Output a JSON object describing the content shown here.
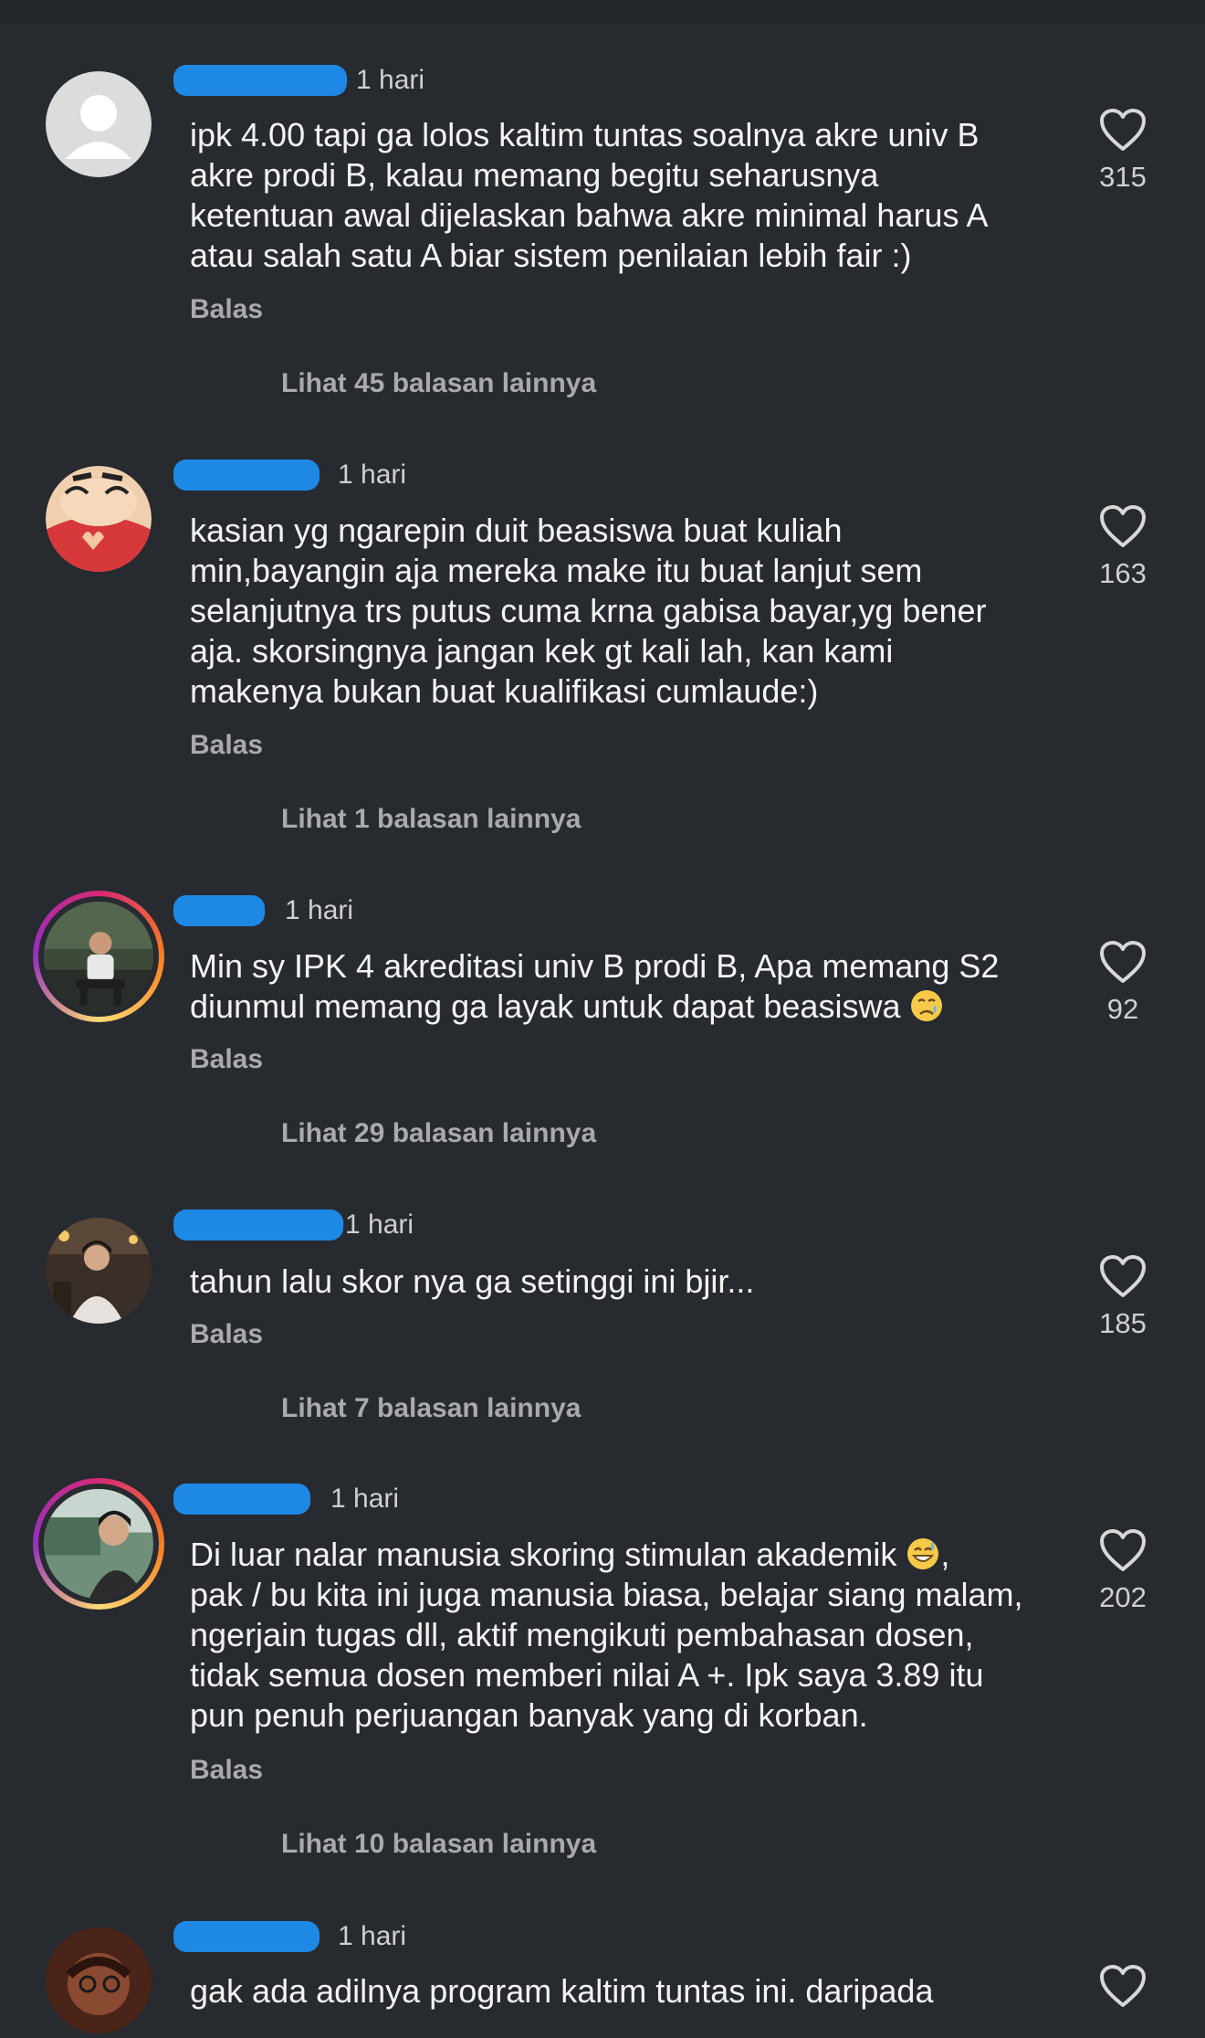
{
  "comments": [
    {
      "time": "1 hari",
      "text": "ipk 4.00 tapi ga lolos kaltim tuntas soalnya akre univ B\nakre prodi B, kalau memang begitu seharusnya\nketentuan awal dijelaskan bahwa akre minimal harus A\natau salah satu A biar sistem penilaian lebih fair :)",
      "reply_label": "Balas",
      "view_replies": "Lihat 45 balasan lainnya",
      "likes": "315",
      "avatar": "default-avatar"
    },
    {
      "time": "1 hari",
      "text": "kasian yg ngarepin duit beasiswa buat kuliah\nmin,bayangin aja mereka make itu buat lanjut sem\nselanjutnya trs putus cuma krna gabisa bayar,yg bener\naja. skorsingnya jangan kek gt kali lah, kan kami\nmakenya bukan buat kualifikasi cumlaude:)",
      "reply_label": "Balas",
      "view_replies": "Lihat 1 balasan lainnya",
      "likes": "163",
      "avatar": "cartoon-avatar"
    },
    {
      "time": "1 hari",
      "text": "Min sy IPK 4 akreditasi univ B prodi B, Apa memang S2\ndiunmul memang ga layak untuk dapat beasiswa",
      "emoji": "crying-face",
      "reply_label": "Balas",
      "view_replies": "Lihat 29 balasan lainnya",
      "likes": "92",
      "avatar": "photo-avatar-sitting"
    },
    {
      "time": "1 hari",
      "text": "tahun lalu skor nya ga setinggi ini bjir...",
      "reply_label": "Balas",
      "view_replies": "Lihat 7 balasan lainnya",
      "likes": "185",
      "avatar": "photo-avatar-portrait"
    },
    {
      "time": "1 hari",
      "text_line1": "Di luar nalar manusia skoring stimulan akademik",
      "text_line1_suffix": ",",
      "text_rest": "pak / bu kita ini juga manusia biasa, belajar siang malam,\nngerjain tugas dll, aktif mengikuti pembahasan dosen,\ntidak semua dosen memberi nilai A +. Ipk saya 3.89 itu\npun penuh perjuangan banyak yang di korban.",
      "emoji": "grinning-sweat-face",
      "reply_label": "Balas",
      "view_replies": "Lihat 10 balasan lainnya",
      "likes": "202",
      "avatar": "photo-avatar-outdoor"
    },
    {
      "time": "1 hari",
      "text": "gak ada adilnya program kaltim tuntas ini. daripada",
      "avatar": "photo-avatar-face"
    }
  ],
  "colors": {
    "background": "#272a2f",
    "redaction": "#1e88e5",
    "muted_text": "#a8aaae"
  }
}
